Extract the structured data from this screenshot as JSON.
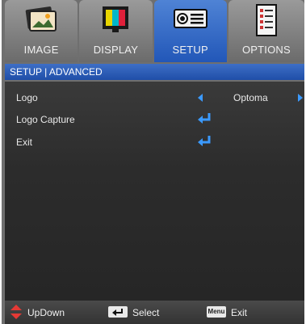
{
  "tabs": [
    {
      "label": "IMAGE",
      "icon": "image-icon",
      "active": false
    },
    {
      "label": "DISPLAY",
      "icon": "display-icon",
      "active": false
    },
    {
      "label": "SETUP",
      "icon": "projector-icon",
      "active": true
    },
    {
      "label": "OPTIONS",
      "icon": "options-icon",
      "active": false
    }
  ],
  "header": {
    "breadcrumb": "SETUP | ADVANCED"
  },
  "menu": {
    "items": [
      {
        "label": "Logo",
        "value": "Optoma"
      },
      {
        "label": "Logo Capture"
      },
      {
        "label": "Exit"
      }
    ]
  },
  "footer": {
    "updown_label": "UpDown",
    "select_label": "Select",
    "menu_key_label": "Menu",
    "exit_label": "Exit"
  },
  "colors": {
    "accent": "#2f66c7",
    "arrow": "#3b9aff",
    "updown_icon": "#e53935"
  }
}
